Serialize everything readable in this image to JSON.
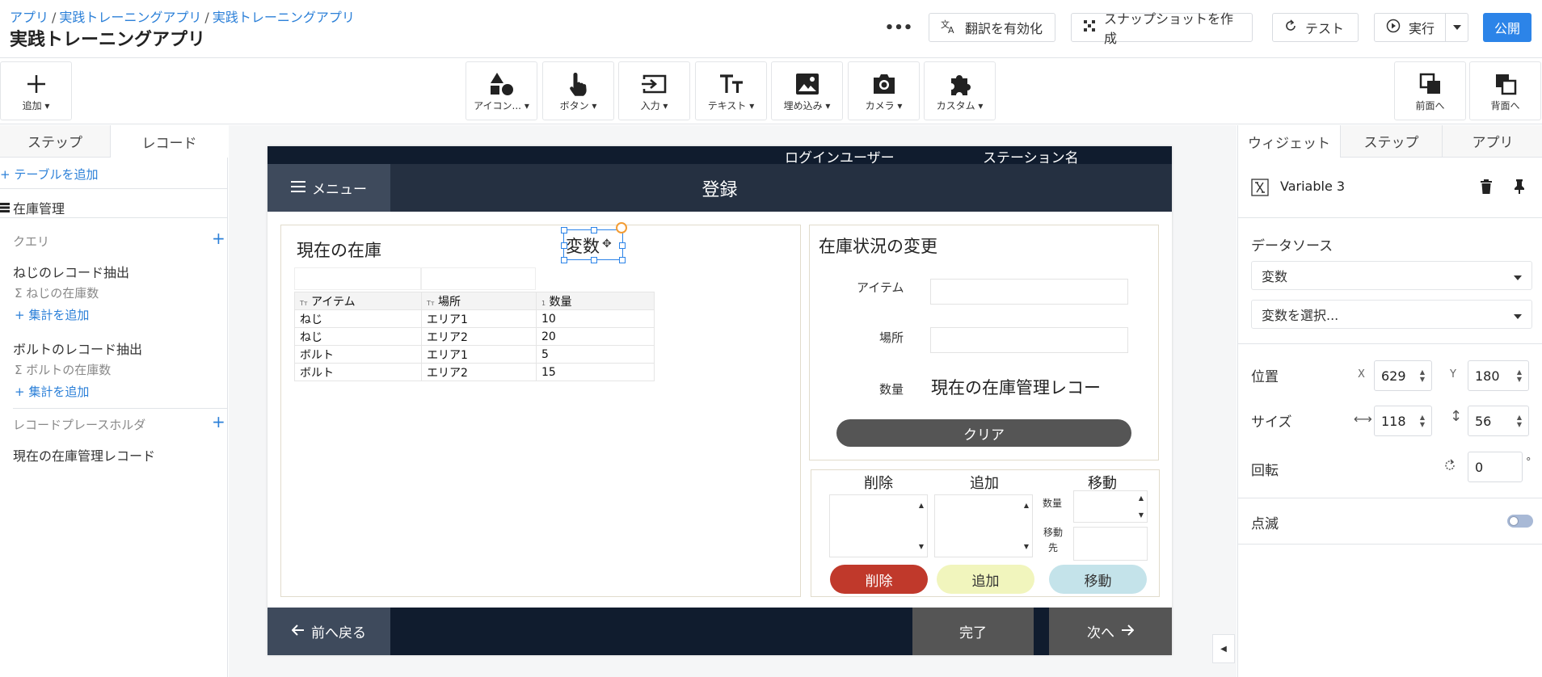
{
  "header": {
    "breadcrumb": [
      "アプリ",
      "実践トレーニングアプリ",
      "実践トレーニングアプリ"
    ],
    "breadcrumb_sep": "/",
    "title": "実践トレーニングアプリ",
    "more": "•••",
    "translate_label": "翻訳を有効化",
    "snapshot_label": "スナップショットを作成",
    "test_label": "テスト",
    "run_label": "実行",
    "publish_label": "公開"
  },
  "toolbar": {
    "add_label": "追加",
    "tools": [
      "アイコン...",
      "ボタン",
      "入力",
      "テキスト",
      "埋め込み",
      "カメラ",
      "カスタム"
    ],
    "bring_front_label": "前面へ",
    "send_back_label": "背面へ"
  },
  "left_panel": {
    "tabs": [
      "ステップ",
      "レコード"
    ],
    "active_tab": "レコード",
    "add_table": "テーブルを追加",
    "table_name": "在庫管理",
    "query_header": "クエリ",
    "queries": [
      {
        "name": "ねじのレコード抽出",
        "aggregate": "ねじの在庫数",
        "add_aggregate": "集計を追加"
      },
      {
        "name": "ボルトのレコード抽出",
        "aggregate": "ボルトの在庫数",
        "add_aggregate": "集計を追加"
      }
    ],
    "placeholder_header": "レコードプレースホルダ",
    "placeholder_item": "現在の在庫管理レコード"
  },
  "screen": {
    "top_user": "ログインユーザー",
    "top_station": "ステーション名",
    "menu_label": "メニュー",
    "title": "登録",
    "current_stock_title": "現在の在庫",
    "variable_label": "変数",
    "table_headers": [
      "アイテム",
      "場所",
      "数量"
    ],
    "table_rows": [
      [
        "ねじ",
        "エリア1",
        "10"
      ],
      [
        "ねじ",
        "エリア2",
        "20"
      ],
      [
        "ボルト",
        "エリア1",
        "5"
      ],
      [
        "ボルト",
        "エリア2",
        "15"
      ]
    ],
    "change_title": "在庫状況の変更",
    "item_label": "アイテム",
    "location_label": "場所",
    "qty_label": "数量",
    "qty_value": "現在の在庫管理レコー",
    "clear_label": "クリア",
    "delete_header": "削除",
    "add_header": "追加",
    "move_header": "移動",
    "move_qty_label": "数量",
    "move_dest_label": "移動先",
    "delete_btn": "削除",
    "add_btn": "追加",
    "move_btn": "移動",
    "back_label": "前へ戻る",
    "done_label": "完了",
    "next_label": "次へ"
  },
  "right_panel": {
    "tabs": [
      "ウィジェット",
      "ステップ",
      "アプリ"
    ],
    "active_tab": "ウィジェット",
    "widget_name": "Variable 3",
    "datasource_label": "データソース",
    "datasource_value": "変数",
    "variable_select": "変数を選択...",
    "position_label": "位置",
    "x_label": "X",
    "x_value": "629",
    "y_label": "Y",
    "y_value": "180",
    "size_label": "サイズ",
    "w_value": "118",
    "h_value": "56",
    "rotation_label": "回転",
    "rotation_value": "0",
    "rotation_unit": "°",
    "blink_label": "点滅"
  },
  "colors": {
    "accent": "#2c84e8",
    "delete": "#c0392b",
    "add": "#f1f5bd",
    "move": "#c4e3ea",
    "clear": "#555555",
    "screen_dark": "#101c2e"
  }
}
